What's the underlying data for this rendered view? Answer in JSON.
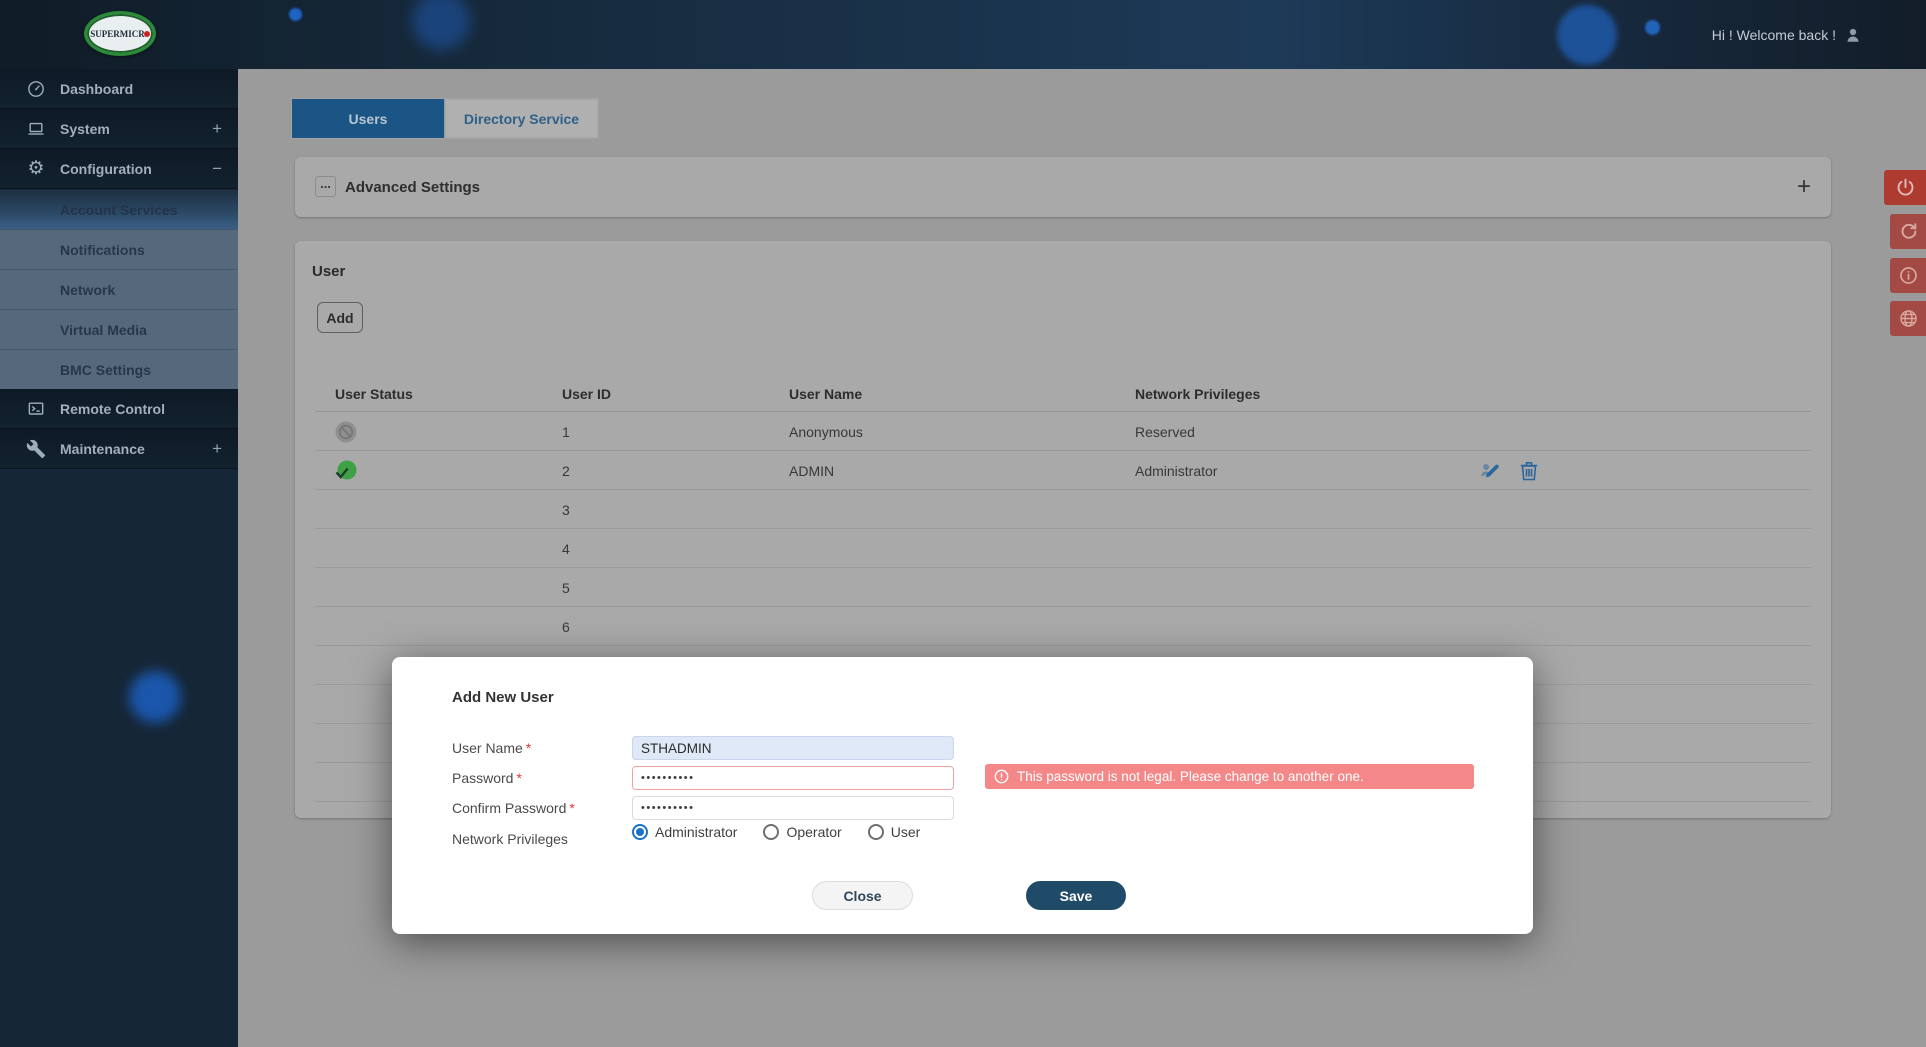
{
  "header": {
    "brand": "SUPERMICR",
    "welcome_text": "Hi ! Welcome back !"
  },
  "sidebar": {
    "items": [
      {
        "label": "Dashboard"
      },
      {
        "label": "System",
        "expand": "+"
      },
      {
        "label": "Configuration",
        "expand": "−"
      },
      {
        "label": "Account Services"
      },
      {
        "label": "Notifications"
      },
      {
        "label": "Network"
      },
      {
        "label": "Virtual Media"
      },
      {
        "label": "BMC Settings"
      },
      {
        "label": "Remote Control"
      },
      {
        "label": "Maintenance",
        "expand": "+"
      }
    ]
  },
  "tabs": {
    "users": "Users",
    "directory": "Directory Service"
  },
  "advanced": {
    "title": "Advanced Settings",
    "menu_dots": "...",
    "expand_plus": "+"
  },
  "user_panel": {
    "title": "User",
    "add_button": "Add",
    "headers": {
      "status": "User Status",
      "id": "User ID",
      "name": "User Name",
      "priv": "Network Privileges"
    },
    "rows": [
      {
        "id": "1",
        "name": "Anonymous",
        "priv": "Reserved",
        "status": "disabled"
      },
      {
        "id": "2",
        "name": "ADMIN",
        "priv": "Administrator",
        "status": "enabled"
      },
      {
        "id": "3",
        "name": "",
        "priv": ""
      },
      {
        "id": "4",
        "name": "",
        "priv": ""
      },
      {
        "id": "5",
        "name": "",
        "priv": ""
      },
      {
        "id": "6",
        "name": "",
        "priv": ""
      },
      {
        "id": "",
        "name": "",
        "priv": ""
      },
      {
        "id": "",
        "name": "",
        "priv": ""
      },
      {
        "id": "",
        "name": "",
        "priv": ""
      },
      {
        "id": "",
        "name": "",
        "priv": ""
      }
    ]
  },
  "toolbar": {
    "buttons": [
      "power",
      "refresh",
      "info",
      "globe"
    ]
  },
  "modal": {
    "title": "Add New User",
    "fields": {
      "user_name": {
        "label": "User Name",
        "required": "*",
        "value": "STHADMIN"
      },
      "password": {
        "label": "Password",
        "required": "*",
        "value": "••••••••••"
      },
      "confirm_password": {
        "label": "Confirm Password",
        "required": "*",
        "value": "••••••••••"
      },
      "privileges": {
        "label": "Network Privileges",
        "options": [
          "Administrator",
          "Operator",
          "User"
        ],
        "selected": "Administrator"
      }
    },
    "error_message": "This password is not legal. Please change to another one.",
    "close_button": "Close",
    "save_button": "Save"
  },
  "colors": {
    "active_tab": "#1a5585",
    "error_pink": "#f48888",
    "save_navy": "#204b68",
    "enabled_green": "#3fa146",
    "toolbar_red": "#ad3b2f",
    "action_blue": "#2b679c"
  }
}
